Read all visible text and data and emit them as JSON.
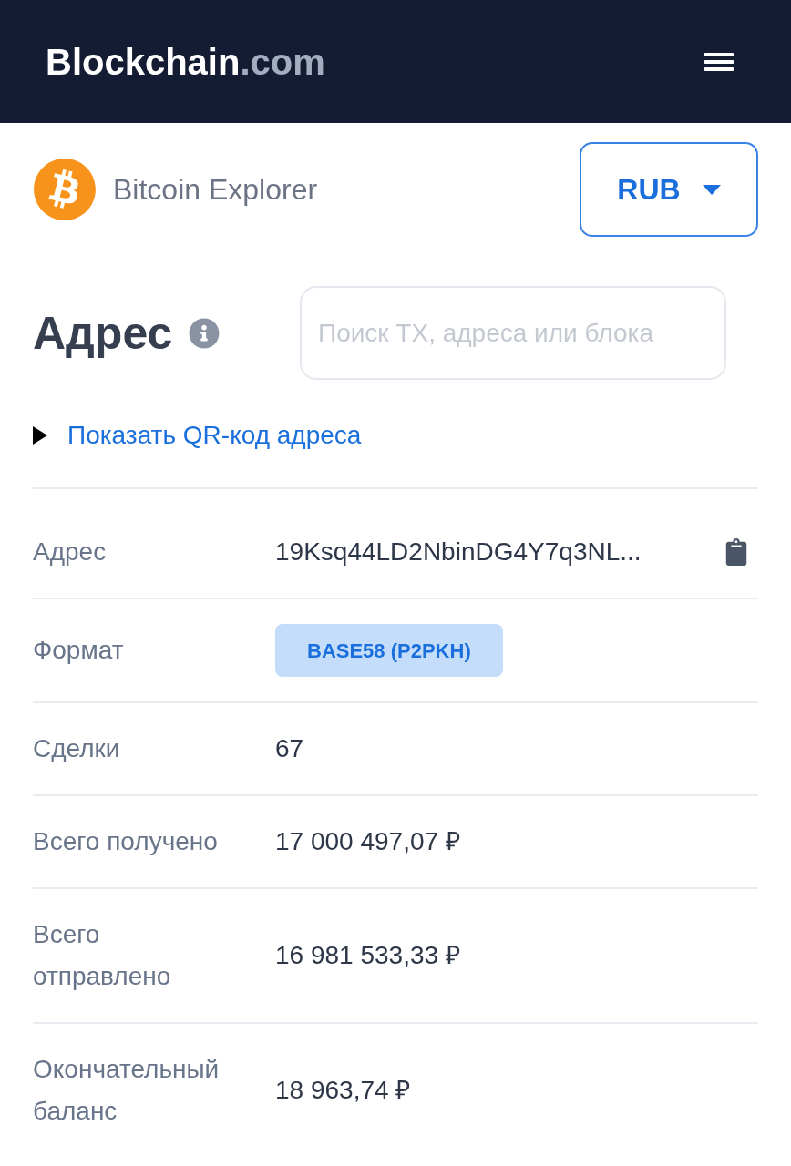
{
  "header": {
    "logo": {
      "name": "Blockchain",
      "suffix": ".com"
    }
  },
  "explorer": {
    "title": "Bitcoin Explorer",
    "currency_button": {
      "label": "RUB"
    }
  },
  "page": {
    "title": "Адрес",
    "search": {
      "placeholder": "Поиск TX, адреса или блока"
    },
    "qr_toggle": {
      "label": "Показать QR-код адреса",
      "expanded": false
    }
  },
  "details": [
    {
      "kind": "copyable",
      "label": "Адрес",
      "value": "19Ksq44LD2NbinDG4Y7q3NL..."
    },
    {
      "kind": "badge",
      "label": "Формат",
      "value": "BASE58 (P2PKH)"
    },
    {
      "kind": "text",
      "label": "Сделки",
      "value": "67"
    },
    {
      "kind": "text",
      "label": "Всего получено",
      "value": "17 000 497,07 ₽"
    },
    {
      "kind": "text",
      "label": "Всего отправлено",
      "value": "16 981 533,33 ₽"
    },
    {
      "kind": "text",
      "label": "Окончательный баланс",
      "value": "18 963,74 ₽"
    }
  ]
}
